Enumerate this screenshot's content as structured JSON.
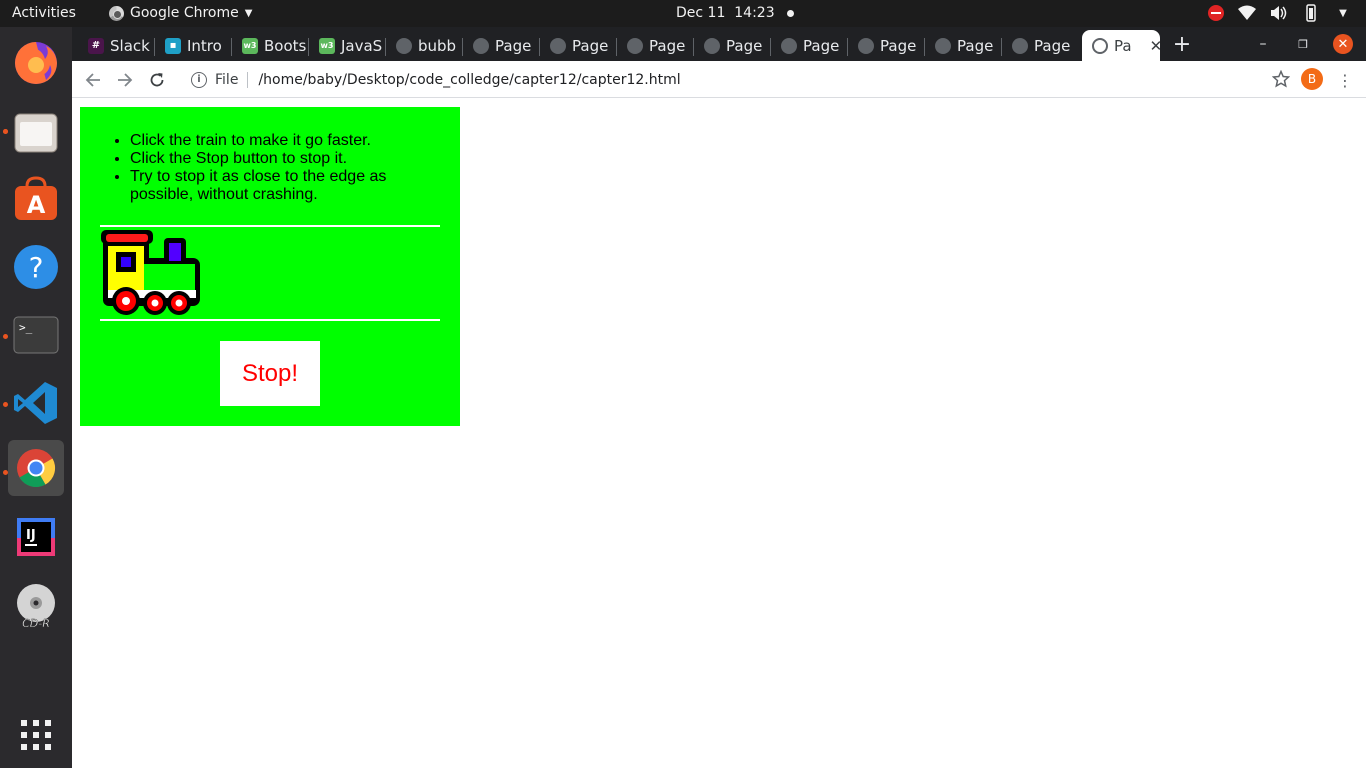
{
  "topbar": {
    "activities": "Activities",
    "app_menu": "Google Chrome",
    "date": "Dec 11",
    "time": "14:23"
  },
  "dock": {
    "items": [
      {
        "name": "firefox",
        "running": true
      },
      {
        "name": "files",
        "running": true
      },
      {
        "name": "software",
        "running": false
      },
      {
        "name": "help",
        "running": false
      },
      {
        "name": "terminal",
        "running": true
      },
      {
        "name": "vscode",
        "running": true
      },
      {
        "name": "chrome",
        "running": true,
        "active": true
      },
      {
        "name": "intellij",
        "running": false
      },
      {
        "name": "cd-r",
        "running": false,
        "label": "CD-R"
      },
      {
        "name": "show-apps",
        "running": false
      }
    ]
  },
  "tabs": [
    {
      "title": "Slack",
      "icon": "slack-icon"
    },
    {
      "title": "Intro",
      "icon": "intro-icon"
    },
    {
      "title": "Boots",
      "icon": "w3-icon"
    },
    {
      "title": "JavaS",
      "icon": "w3-icon"
    },
    {
      "title": "bubb",
      "icon": "globe-icon"
    },
    {
      "title": "Page",
      "icon": "globe-icon"
    },
    {
      "title": "Page",
      "icon": "globe-icon"
    },
    {
      "title": "Page",
      "icon": "globe-icon"
    },
    {
      "title": "Page",
      "icon": "globe-icon"
    },
    {
      "title": "Page",
      "icon": "globe-icon"
    },
    {
      "title": "Page",
      "icon": "globe-icon"
    },
    {
      "title": "Page",
      "icon": "globe-icon"
    },
    {
      "title": "Page",
      "icon": "globe-icon"
    },
    {
      "title": "Pa",
      "icon": "globe-icon",
      "active": true
    }
  ],
  "toolbar": {
    "scheme": "File",
    "url": "/home/baby/Desktop/code_colledge/capter12/capter12.html",
    "profile_initial": "B"
  },
  "game": {
    "instructions": [
      "Click the train to make it go faster.",
      "Click the Stop button to stop it.",
      "Try to stop it as close to the edge as possible, without crashing."
    ],
    "stop_label": "Stop!"
  },
  "colors": {
    "game_background": "#00ff00",
    "stop_text": "#ff0000",
    "accent": "#e95420"
  }
}
